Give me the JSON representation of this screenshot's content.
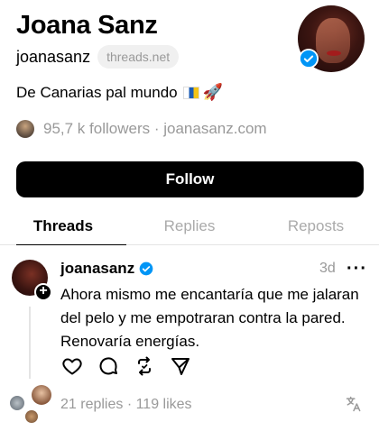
{
  "profile": {
    "name": "Joana Sanz",
    "handle": "joanasanz",
    "domain_pill": "threads.net",
    "bio": "De Canarias pal mundo",
    "followers": "95,7 k followers · joanasanz.com",
    "follow_label": "Follow"
  },
  "tabs": [
    {
      "label": "Threads",
      "active": true
    },
    {
      "label": "Replies",
      "active": false
    },
    {
      "label": "Reposts",
      "active": false
    }
  ],
  "post": {
    "username": "joanasanz",
    "time": "3d",
    "more": "···",
    "text": "Ahora mismo me encantaría que me jalaran del pelo y me empotraran contra la pared. Renovaría energías.",
    "stats": "21 replies · 119 likes"
  },
  "icons": {
    "verified": "verified-badge-icon",
    "like": "heart-icon",
    "reply": "comment-icon",
    "repost": "repost-icon",
    "share": "send-icon",
    "translate": "translate-icon"
  },
  "colors": {
    "verified": "#0095f6",
    "muted": "#999999",
    "button": "#000000"
  }
}
